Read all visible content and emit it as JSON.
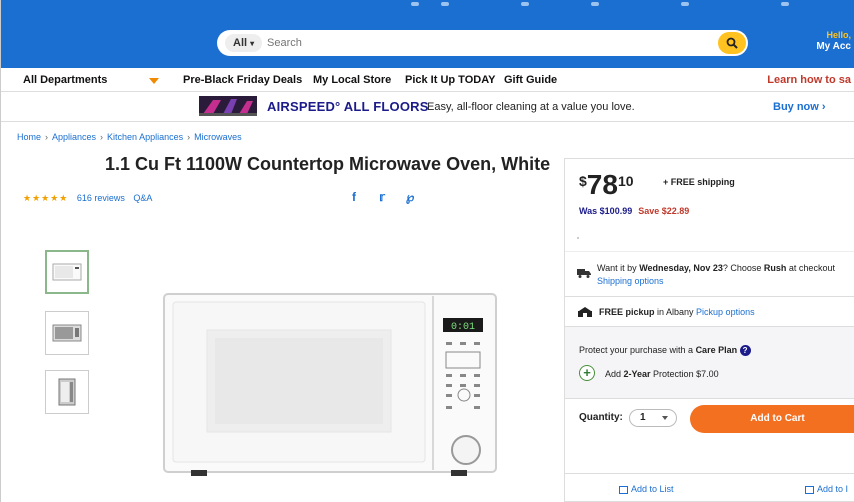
{
  "header": {
    "search_dept": "All",
    "search_placeholder": "Search",
    "account_greeting": "Hello,",
    "account_label": "My Acc"
  },
  "nav": {
    "all_departments": "All Departments",
    "items": [
      "Pre-Black Friday Deals",
      "My Local Store",
      "Pick It Up TODAY",
      "Gift Guide"
    ],
    "learn": "Learn how to sa"
  },
  "banner": {
    "brand": "AIRSPEED° ALL FLOORS",
    "tagline": "Easy, all-floor cleaning at a value you love.",
    "cta": "Buy now ›"
  },
  "breadcrumb": [
    "Home",
    "Appliances",
    "Kitchen Appliances",
    "Microwaves"
  ],
  "product": {
    "title": "1.1 Cu Ft 1100W Countertop Microwave Oven, White",
    "stars": "★★★★★",
    "reviews": "616 reviews",
    "qa": "Q&A",
    "display_time": "0:01"
  },
  "buybox": {
    "currency": "$",
    "dollars": "78",
    "cents": "10",
    "shipping": "+ FREE shipping",
    "was": "Was $100.99",
    "save": "Save $22.89",
    "rush_text_1": "Want it by ",
    "rush_date": "Wednesday, Nov 23",
    "rush_text_2": "? Choose ",
    "rush_rush": "Rush",
    "rush_text_3": " at checkout",
    "shipping_options": "Shipping options",
    "pickup_bold": "FREE pickup",
    "pickup_loc": " in Albany ",
    "pickup_options": "Pickup options",
    "care_text": "Protect your purchase with a ",
    "care_bold": "Care Plan",
    "care_add_1": "Add ",
    "care_add_bold": "2-Year",
    "care_add_2": " Protection $7.00",
    "quantity_label": "Quantity:",
    "quantity_value": "1",
    "add_to_cart": "Add to Cart",
    "add_to_list": "Add to List",
    "add_to_registry": "Add to I"
  },
  "colors": {
    "brand_blue": "#1b6fd1",
    "cta_orange": "#f37021",
    "spark_yellow": "#ffc220",
    "sale_red": "#c0392b"
  }
}
